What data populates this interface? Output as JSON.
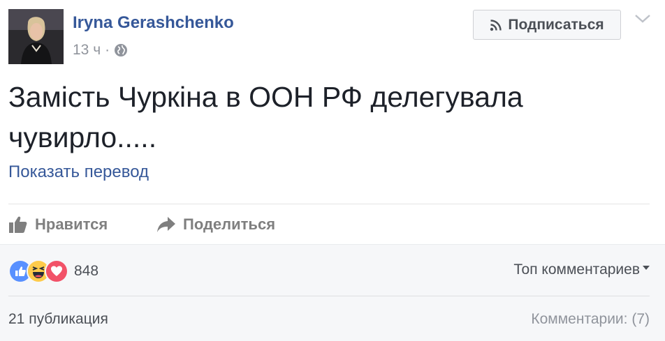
{
  "post": {
    "author": "Iryna Gerashchenko",
    "time": "13 ч",
    "separator": "·",
    "subscribe_label": "Подписаться",
    "text": "Замість Чуркіна в ООН РФ делегувала чувирло.....",
    "translate_label": "Показать перевод"
  },
  "actions": {
    "like_label": "Нравится",
    "share_label": "Поделиться"
  },
  "feedback": {
    "reaction_count": "848",
    "reactions": [
      "like-icon",
      "haha-icon",
      "love-icon"
    ],
    "top_comments_label": "Топ комментариев",
    "shares_label": "21 публикация",
    "comments_label": "Комментарии: (7)"
  },
  "colors": {
    "link": "#365899",
    "muted": "#90949c",
    "like_blue": "#5890ff",
    "love_red": "#f25268",
    "haha_yellow": "#fecb4b"
  }
}
